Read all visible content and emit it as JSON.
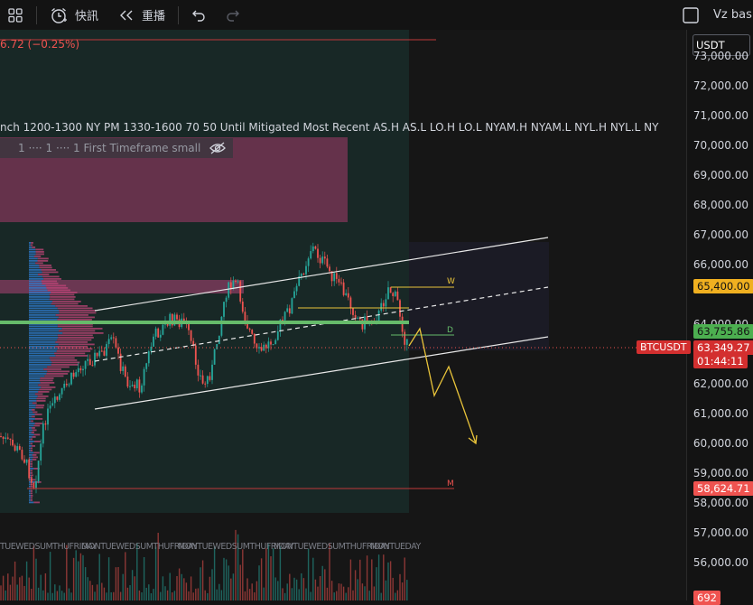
{
  "toolbar": {
    "flash_news_label": "快訊",
    "replay_label": "重播",
    "right_label": "Vz basi"
  },
  "chart": {
    "change_text": "6.72 (−0.25%)",
    "indicator_text": "nch 1200-1300 NY PM 1330-1600 70 50 Until Mitigated Most Recent AS.H AS.L LO.H LO.L NYAM.H NYAM.L NYL.H NYL.L NY",
    "legend_text": "1 ···· 1 ···· 1 First Timeframe small",
    "level_w": "W",
    "level_d": "D",
    "level_m": "M",
    "time_labels": [
      "TUEWEDSUMTHUFRIDAY",
      "MONTUEWEDSUMTHUFRIDAY",
      "MONTUEWEDSUMTHUFRIDAY",
      "MONTUEWEDSUMTHUFRIDAY",
      "MONTUEDAY"
    ],
    "colors": {
      "up": "#26a69a",
      "down": "#ef5350",
      "accent": "#4caf50",
      "yellow": "#e8c33a"
    }
  },
  "price_axis": {
    "currency": "USDT",
    "labels": [
      "73,000.00",
      "72,000.00",
      "71,000.00",
      "70,000.00",
      "69,000.00",
      "68,000.00",
      "67,000.00",
      "66,000.00",
      "64,000.00",
      "62,000.00",
      "61,000.00",
      "60,000.00",
      "59,000.00",
      "58,000.00",
      "57,000.00",
      "56,000.00"
    ],
    "tag_65400": "65,400.00",
    "tag_63755": "63,755.86",
    "symbol": "BTCUSDT",
    "price_current": "63,349.27",
    "countdown": "01:44:11",
    "tag_58624": "58,624.71",
    "bottom_tag": "692"
  }
}
